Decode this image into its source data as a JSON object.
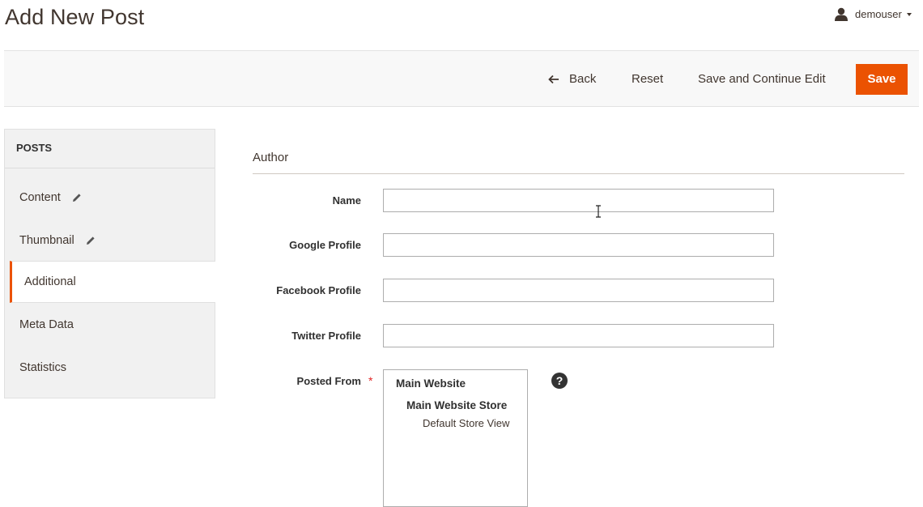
{
  "page": {
    "title": "Add New Post"
  },
  "header": {
    "username": "demouser"
  },
  "toolbar": {
    "back_label": "Back",
    "reset_label": "Reset",
    "save_continue_label": "Save and Continue Edit",
    "save_label": "Save"
  },
  "sidebar": {
    "heading": "POSTS",
    "items": [
      {
        "label": "Content",
        "icon": "pencil-icon",
        "active": false
      },
      {
        "label": "Thumbnail",
        "icon": "pencil-icon",
        "active": false
      },
      {
        "label": "Additional",
        "active": true
      },
      {
        "label": "Meta Data",
        "active": false
      },
      {
        "label": "Statistics",
        "active": false
      }
    ]
  },
  "form": {
    "section_title": "Author",
    "fields": {
      "name": {
        "label": "Name",
        "value": ""
      },
      "google": {
        "label": "Google Profile",
        "value": ""
      },
      "facebook": {
        "label": "Facebook Profile",
        "value": ""
      },
      "twitter": {
        "label": "Twitter Profile",
        "value": ""
      }
    },
    "posted_from": {
      "label": "Posted From",
      "required_mark": "*",
      "options": {
        "website": "Main Website",
        "store": "Main Website Store",
        "view": "Default Store View"
      },
      "help_glyph": "?"
    }
  },
  "colors": {
    "accent": "#eb5202",
    "required": "#e22626",
    "text": "#41362f"
  }
}
